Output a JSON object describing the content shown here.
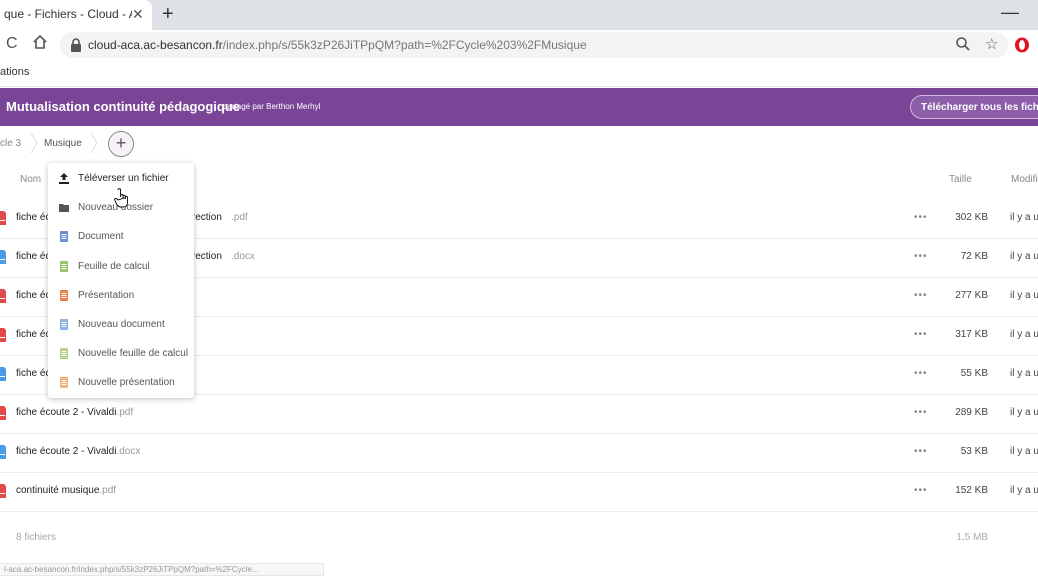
{
  "browser": {
    "tab_title": "que - Fichiers - Cloud - Acad",
    "url_host": "cloud-aca.ac-besancon.fr",
    "url_path": "/index.php/s/55k3zP26JiTPpQM?path=%2FCycle%203%2FMusique",
    "bookmark_text": "ations"
  },
  "header": {
    "title": "Mutualisation continuité pédagogique",
    "shared_by": "partagé par Berthon Merhyl",
    "download_all": "Télécharger tous les fichiers"
  },
  "breadcrumb": [
    "cle 3",
    "Musique"
  ],
  "columns": {
    "name": "Nom",
    "size": "Taille",
    "modified": "Modifi"
  },
  "new_menu": [
    {
      "label": "Téléverser un fichier",
      "icon": "upload-icon",
      "color": "#222222"
    },
    {
      "label": "Nouveau dossier",
      "icon": "folder-icon",
      "color": "#555555"
    },
    {
      "label": "Document",
      "icon": "document-icon",
      "color": "#6d8ccf"
    },
    {
      "label": "Feuille de calcul",
      "icon": "spreadsheet-icon",
      "color": "#9bc46c"
    },
    {
      "label": "Présentation",
      "icon": "presentation-icon",
      "color": "#e88550"
    },
    {
      "label": "Nouveau document",
      "icon": "new-document-icon",
      "color": "#88b5e6"
    },
    {
      "label": "Nouvelle feuille de calcul",
      "icon": "new-spreadsheet-icon",
      "color": "#b7d489"
    },
    {
      "label": "Nouvelle présentation",
      "icon": "new-presentation-icon",
      "color": "#f0b27a"
    }
  ],
  "files": [
    {
      "name": "fiche éc",
      "name_end": "orrection",
      "ext": ".pdf",
      "type": "pdf",
      "size": "302 KB",
      "modified": "il y a u"
    },
    {
      "name": "fiche éc",
      "name_end": "orrection",
      "ext": ".docx",
      "type": "docx",
      "size": "72 KB",
      "modified": "il y a u"
    },
    {
      "name": "fiche éc",
      "name_end": "",
      "ext": "",
      "type": "pdf",
      "size": "277 KB",
      "modified": "il y a u"
    },
    {
      "name": "fiche éc",
      "name_end": "",
      "ext": "",
      "type": "pdf",
      "size": "317 KB",
      "modified": "il y a u"
    },
    {
      "name": "fiche éc",
      "name_end": "",
      "ext": "",
      "type": "docx",
      "size": "55 KB",
      "modified": "il y a u"
    },
    {
      "name": "fiche écoute 2 - Vivaldi",
      "name_end": "",
      "ext": ".pdf",
      "type": "pdf",
      "size": "289 KB",
      "modified": "il y a u"
    },
    {
      "name": "fiche écoute 2 - Vivaldi",
      "name_end": "",
      "ext": ".docx",
      "type": "docx",
      "size": "53 KB",
      "modified": "il y a u"
    },
    {
      "name": "continuité musique",
      "name_end": "",
      "ext": ".pdf",
      "type": "pdf",
      "size": "152 KB",
      "modified": "il y a u"
    }
  ],
  "footer": {
    "count": "8 fichiers",
    "total": "1,5 MB"
  },
  "status_url": "l-aca.ac-besancon.fr/index.php/s/55k3zP26JiTPpQM?path=%2FCycle...",
  "colors": {
    "header": "#7a4596",
    "pdf": "#e04a4a",
    "docx": "#4a9be6"
  }
}
